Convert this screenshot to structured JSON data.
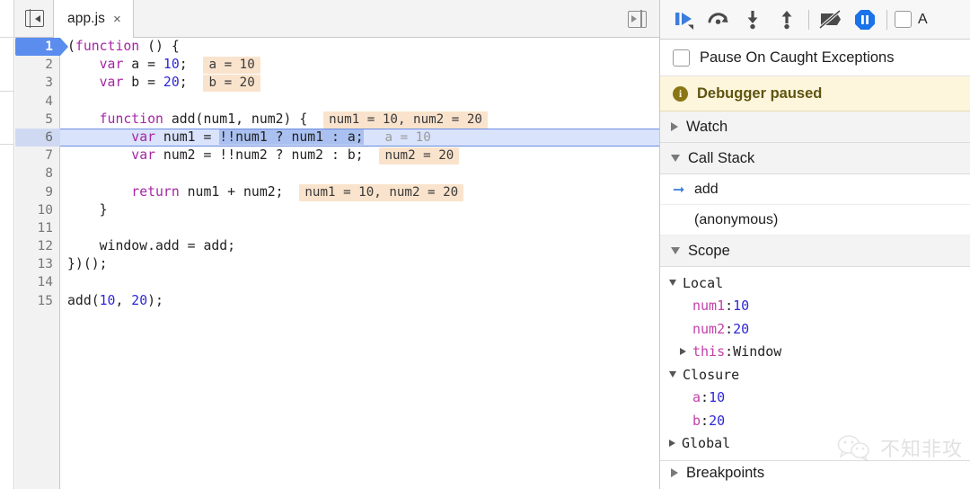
{
  "editor": {
    "collapse_icon": "panel-collapse-left-icon",
    "expand_icon": "panel-expand-right-icon",
    "tab": {
      "name": "app.js",
      "close": "×"
    },
    "lines": [
      {
        "n": "1",
        "exec": true,
        "paused": false
      },
      {
        "n": "2",
        "exec": false,
        "paused": false,
        "hint": "a = 10"
      },
      {
        "n": "3",
        "exec": false,
        "paused": false,
        "hint": "b = 20"
      },
      {
        "n": "4",
        "exec": false,
        "paused": false
      },
      {
        "n": "5",
        "exec": false,
        "paused": false,
        "hint": "num1 = 10, num2 = 20"
      },
      {
        "n": "6",
        "exec": false,
        "paused": true,
        "hint": "a = 10"
      },
      {
        "n": "7",
        "exec": false,
        "paused": false,
        "hint": "num2 = 20"
      },
      {
        "n": "8",
        "exec": false,
        "paused": false
      },
      {
        "n": "9",
        "exec": false,
        "paused": false,
        "hint": "num1 = 10, num2 = 20"
      },
      {
        "n": "10",
        "exec": false,
        "paused": false
      },
      {
        "n": "11",
        "exec": false,
        "paused": false
      },
      {
        "n": "12",
        "exec": false,
        "paused": false
      },
      {
        "n": "13",
        "exec": false,
        "paused": false
      },
      {
        "n": "14",
        "exec": false,
        "paused": false
      },
      {
        "n": "15",
        "exec": false,
        "paused": false
      }
    ],
    "code": {
      "l1": "(function () {",
      "l2": "    var a = 10;",
      "l3": "    var b = 20;",
      "l4": "",
      "l5": "    function add(num1, num2) {",
      "l6_pre": "        var num1 = ",
      "l6_sel": "!!num1 ? num1 : a;",
      "l7": "        var num2 = !!num2 ? num2 : b;",
      "l8": "",
      "l9": "        return num1 + num2;",
      "l10": "    }",
      "l11": "",
      "l12": "    window.add = add;",
      "l13": "})();",
      "l14": "",
      "l15": "add(10, 20);"
    }
  },
  "debugger": {
    "toolbar": [
      {
        "name": "resume-script-execution-button",
        "icon": "resume-icon"
      },
      {
        "name": "step-over-button",
        "icon": "step-over-icon"
      },
      {
        "name": "step-into-button",
        "icon": "step-into-icon"
      },
      {
        "name": "step-out-button",
        "icon": "step-out-icon"
      },
      {
        "name": "deactivate-breakpoints-button",
        "icon": "deactivate-breakpoints-icon"
      },
      {
        "name": "pause-on-exceptions-button",
        "icon": "pause-on-exceptions-icon"
      }
    ],
    "async_label": "A",
    "caught_exceptions_label": "Pause On Caught Exceptions",
    "paused_banner": "Debugger paused",
    "sections": {
      "watch": "Watch",
      "call_stack": "Call Stack",
      "scope": "Scope",
      "breakpoints": "Breakpoints"
    },
    "call_stack": [
      {
        "label": "add",
        "current": true
      },
      {
        "label": "(anonymous)",
        "current": false
      }
    ],
    "scope": {
      "local": {
        "title": "Local",
        "entries": [
          {
            "key": "num1",
            "sep": ": ",
            "value": "10",
            "kind": "number"
          },
          {
            "key": "num2",
            "sep": ": ",
            "value": "20",
            "kind": "number"
          },
          {
            "key": "this",
            "sep": ": ",
            "value": "Window",
            "kind": "object"
          }
        ]
      },
      "closure": {
        "title": "Closure",
        "entries": [
          {
            "key": "a",
            "sep": ": ",
            "value": "10",
            "kind": "number"
          },
          {
            "key": "b",
            "sep": ": ",
            "value": "20",
            "kind": "number"
          }
        ]
      },
      "global": {
        "title": "Global"
      }
    }
  },
  "watermark": {
    "text": "不知非攻",
    "icon": "wechat-icon"
  },
  "colors": {
    "accent_blue": "#5b8def",
    "paused_row": "#d9e3fb",
    "hint_bg": "#fae3cc",
    "banner_bg": "#fdf6dd",
    "keyword": "#a626a4",
    "number": "#2f27d6",
    "property": "#c341a8"
  }
}
